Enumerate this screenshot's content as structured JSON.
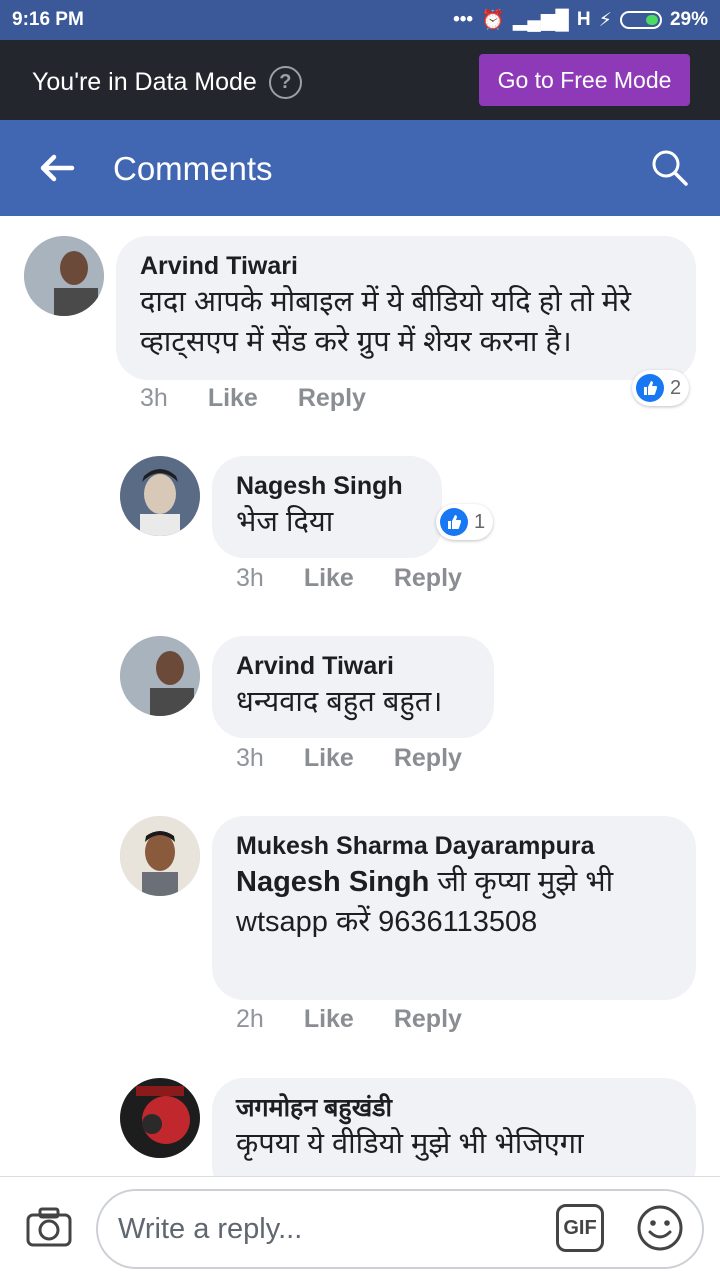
{
  "status": {
    "time": "9:16 PM",
    "network": "H",
    "battery": "29%"
  },
  "banner": {
    "text": "You're in Data Mode",
    "help": "?",
    "button": "Go to Free Mode"
  },
  "header": {
    "title": "Comments"
  },
  "comments": [
    {
      "name": "Arvind Tiwari",
      "body": "दादा आपके मोबाइल में ये बीडियो यदि हो तो मेरे व्हाट्सएप में सेंड करे ग्रुप में शेयर करना है।",
      "time": "3h",
      "like": "Like",
      "reply": "Reply",
      "reactions": "2"
    },
    {
      "name": "Nagesh Singh",
      "body": "भेज दिया",
      "time": "3h",
      "like": "Like",
      "reply": "Reply",
      "reactions": "1"
    },
    {
      "name": "Arvind Tiwari",
      "body": "धन्यवाद बहुत बहुत।",
      "time": "3h",
      "like": "Like",
      "reply": "Reply"
    },
    {
      "name": "Mukesh Sharma Dayarampura",
      "mention": "Nagesh Singh",
      "body": " जी कृप्या मुझे भी wtsapp करें 9636113508",
      "time": "2h",
      "like": "Like",
      "reply": "Reply"
    },
    {
      "name": "जगमोहन बहुखंडी",
      "body": "कृपया ये वीडियो मुझे भी भेजिएगा"
    }
  ],
  "composer": {
    "placeholder": "Write a reply...",
    "gif": "GIF"
  }
}
